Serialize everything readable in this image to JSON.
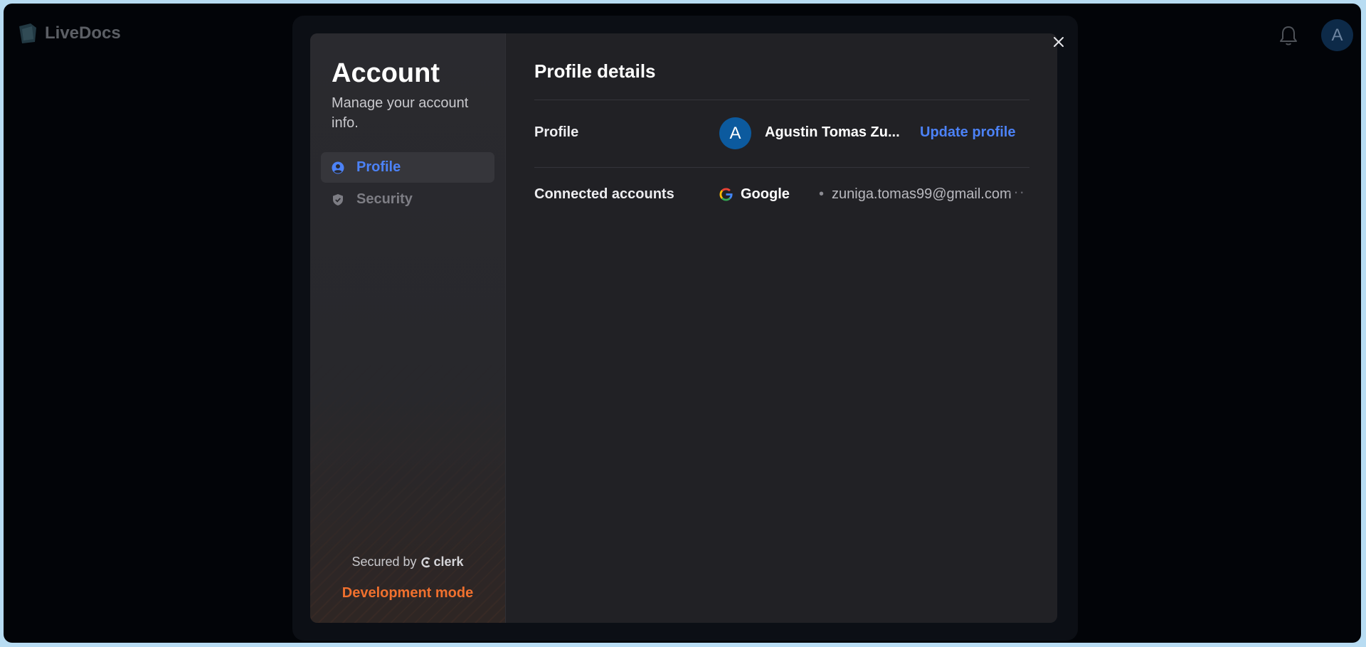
{
  "app": {
    "name": "LiveDocs",
    "avatar_initial": "A"
  },
  "modal": {
    "sidebar": {
      "title": "Account",
      "subtitle": "Manage your account info.",
      "items": [
        {
          "label": "Profile",
          "icon": "user-circle-icon",
          "active": true
        },
        {
          "label": "Security",
          "icon": "shield-icon",
          "active": false
        }
      ],
      "secured_by": "Secured by",
      "brand": "clerk",
      "dev_mode": "Development mode"
    },
    "main": {
      "title": "Profile details",
      "profile": {
        "label": "Profile",
        "avatar_initial": "A",
        "name": "Agustin Tomas Zu...",
        "action": "Update profile"
      },
      "connected": {
        "label": "Connected accounts",
        "provider": "Google",
        "separator": "•",
        "email": "zuniga.tomas99@gmail.com",
        "more": "···"
      }
    },
    "close_icon": "close-icon"
  },
  "colors": {
    "accent": "#4c82f7",
    "dev_mode": "#f0702e",
    "avatar": "#0c5a9e"
  }
}
